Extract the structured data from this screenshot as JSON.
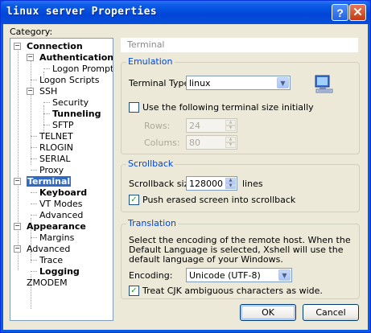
{
  "window": {
    "title": "linux server Properties"
  },
  "titlebar": {
    "help_label": "?",
    "close_label": "✕"
  },
  "category_label": "Category:",
  "tree": [
    {
      "label": "Connection",
      "bold": true,
      "selected": false
    },
    {
      "label": "Authentication",
      "bold": true,
      "selected": false
    },
    {
      "label": "Logon Prompts",
      "bold": false,
      "selected": false
    },
    {
      "label": "Logon Scripts",
      "bold": false,
      "selected": false
    },
    {
      "label": "SSH",
      "bold": false,
      "selected": false
    },
    {
      "label": "Security",
      "bold": false,
      "selected": false
    },
    {
      "label": "Tunneling",
      "bold": true,
      "selected": false
    },
    {
      "label": "SFTP",
      "bold": false,
      "selected": false
    },
    {
      "label": "TELNET",
      "bold": false,
      "selected": false
    },
    {
      "label": "RLOGIN",
      "bold": false,
      "selected": false
    },
    {
      "label": "SERIAL",
      "bold": false,
      "selected": false
    },
    {
      "label": "Proxy",
      "bold": false,
      "selected": false
    },
    {
      "label": "Terminal",
      "bold": true,
      "selected": true
    },
    {
      "label": "Keyboard",
      "bold": true,
      "selected": false
    },
    {
      "label": "VT Modes",
      "bold": false,
      "selected": false
    },
    {
      "label": "Advanced",
      "bold": false,
      "selected": false
    },
    {
      "label": "Appearance",
      "bold": true,
      "selected": false
    },
    {
      "label": "Margins",
      "bold": false,
      "selected": false
    },
    {
      "label": "Advanced",
      "bold": false,
      "selected": false
    },
    {
      "label": "Trace",
      "bold": false,
      "selected": false
    },
    {
      "label": "Logging",
      "bold": true,
      "selected": false
    },
    {
      "label": "ZMODEM",
      "bold": false,
      "selected": false
    }
  ],
  "panel": {
    "header": "Terminal"
  },
  "emulation": {
    "title": "Emulation",
    "terminal_type_label": "Terminal Type:",
    "terminal_type_value": "linux",
    "icon": "terminal-monitor-icon",
    "use_size_label": "Use the following terminal size initially",
    "use_size_checked": false,
    "rows_label": "Rows:",
    "rows_value": "24",
    "columns_label": "Colums:",
    "columns_value": "80"
  },
  "scrollback": {
    "title": "Scrollback",
    "size_label": "Scrollback size:",
    "size_value": "128000",
    "size_unit": "lines",
    "push_label": "Push erased screen into scrollback",
    "push_checked": true
  },
  "translation": {
    "title": "Translation",
    "description": "Select the encoding of the remote host. When the Default Language is selected, Xshell will use the default language of your Windows.",
    "encoding_label": "Encoding:",
    "encoding_value": "Unicode (UTF-8)",
    "cjk_label": "Treat CJK ambiguous characters as wide.",
    "cjk_checked": true
  },
  "buttons": {
    "ok": "OK",
    "cancel": "Cancel"
  },
  "colors": {
    "titlebar": "#0a5be6",
    "dialog_bg": "#ece9d8",
    "group_title": "#0046d5",
    "selection": "#316ac5"
  }
}
